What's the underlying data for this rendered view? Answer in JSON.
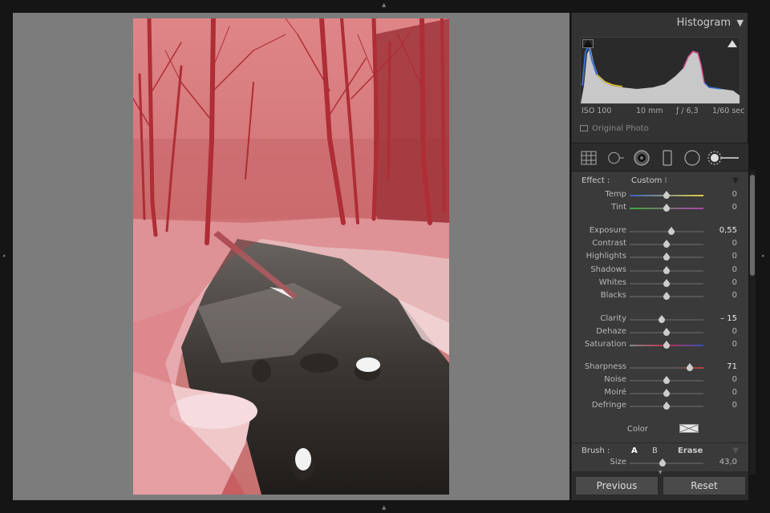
{
  "panel": {
    "histogram": {
      "title": "Histogram",
      "iso": "ISO 100",
      "focal_length": "10 mm",
      "aperture": "ƒ / 6,3",
      "shutter": "1/60 sec",
      "original_photo_label": "Original Photo"
    },
    "tools": [
      "crop-overlay",
      "spot-removal",
      "red-eye",
      "graduated-filter",
      "radial-filter",
      "adjustment-brush"
    ],
    "effect": {
      "label": "Effect :",
      "preset": "Custom ⁝",
      "sliders": [
        {
          "label": "Temp",
          "value": "0",
          "pos": 0.5
        },
        {
          "label": "Tint",
          "value": "0",
          "pos": 0.5
        },
        {
          "label": "Exposure",
          "value": "0,55",
          "pos": 0.57
        },
        {
          "label": "Contrast",
          "value": "0",
          "pos": 0.5
        },
        {
          "label": "Highlights",
          "value": "0",
          "pos": 0.5
        },
        {
          "label": "Shadows",
          "value": "0",
          "pos": 0.5
        },
        {
          "label": "Whites",
          "value": "0",
          "pos": 0.5
        },
        {
          "label": "Blacks",
          "value": "0",
          "pos": 0.5
        },
        {
          "label": "Clarity",
          "value": "– 15",
          "pos": 0.43
        },
        {
          "label": "Dehaze",
          "value": "0",
          "pos": 0.5
        },
        {
          "label": "Saturation",
          "value": "0",
          "pos": 0.5
        },
        {
          "label": "Sharpness",
          "value": "71",
          "pos": 0.81
        },
        {
          "label": "Noise",
          "value": "0",
          "pos": 0.5
        },
        {
          "label": "Moiré",
          "value": "0",
          "pos": 0.5
        },
        {
          "label": "Defringe",
          "value": "0",
          "pos": 0.5
        }
      ],
      "color_label": "Color"
    },
    "brush": {
      "label": "Brush :",
      "option_a": "A",
      "option_b": "B",
      "option_erase": "Erase",
      "size_label": "Size",
      "size_value": "43,0",
      "size_pos": 0.45
    },
    "buttons": {
      "previous": "Previous",
      "reset": "Reset"
    }
  },
  "colors": {
    "accent_overlay": "#c8323c",
    "panel_bg": "#3a3a3a",
    "canvas_bg": "#7c7c7c"
  }
}
